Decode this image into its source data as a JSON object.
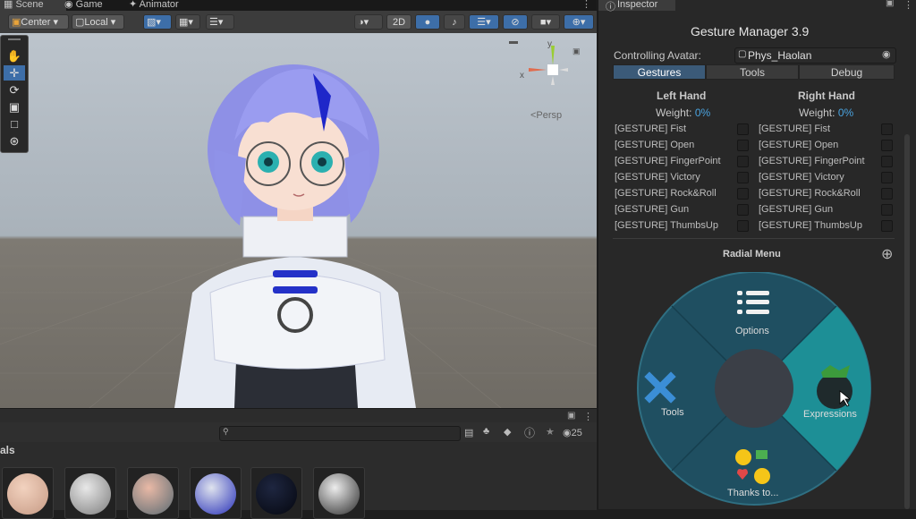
{
  "tabs": {
    "scene": "Scene",
    "game": "Game",
    "animator": "Animator",
    "inspector": "Inspector"
  },
  "scene_toolbar": {
    "pivot": "Center",
    "space": "Local",
    "mode_2d": "2D"
  },
  "viewport": {
    "persp_label": "<Persp",
    "gizmo_x": "x",
    "gizmo_y": "y"
  },
  "bottom": {
    "partial_label": "als",
    "hidden_count": "25",
    "search_placeholder": ""
  },
  "inspector": {
    "title": "Gesture Manager 3.9",
    "controlling_label": "Controlling Avatar:",
    "avatar": "Phys_Haolan",
    "tabs": [
      "Gestures",
      "Tools",
      "Debug"
    ],
    "left_hand": "Left Hand",
    "right_hand": "Right Hand",
    "weight_label": "Weight:",
    "left_weight": "0%",
    "right_weight": "0%",
    "gestures": [
      "[GESTURE] Fist",
      "[GESTURE] Open",
      "[GESTURE] FingerPoint",
      "[GESTURE] Victory",
      "[GESTURE] Rock&Roll",
      "[GESTURE] Gun",
      "[GESTURE] ThumbsUp"
    ],
    "radial_title": "Radial Menu",
    "radial_items": {
      "options": "Options",
      "expressions": "Expressions",
      "thanks": "Thanks to...",
      "tools": "Tools"
    }
  },
  "colors": {
    "accent": "#3b82c4",
    "radial_bg": "#1f4f61",
    "radial_highlight": "#1d8f96",
    "weight": "#4aa3df"
  }
}
